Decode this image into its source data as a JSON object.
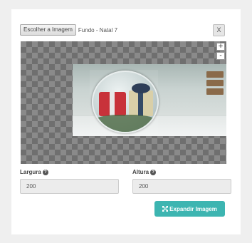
{
  "file_picker": {
    "button_label": "Escolher a Imagem",
    "file_name": "Fundo - Natal 7",
    "close_label": "X"
  },
  "zoom": {
    "in_label": "+",
    "out_label": "-"
  },
  "width_field": {
    "label": "Largura",
    "value": "200"
  },
  "height_field": {
    "label": "Altura",
    "value": "200"
  },
  "expand_button": {
    "label": "Expandir Imagem",
    "icon": "expand-icon"
  },
  "colors": {
    "accent": "#3db5b1"
  }
}
